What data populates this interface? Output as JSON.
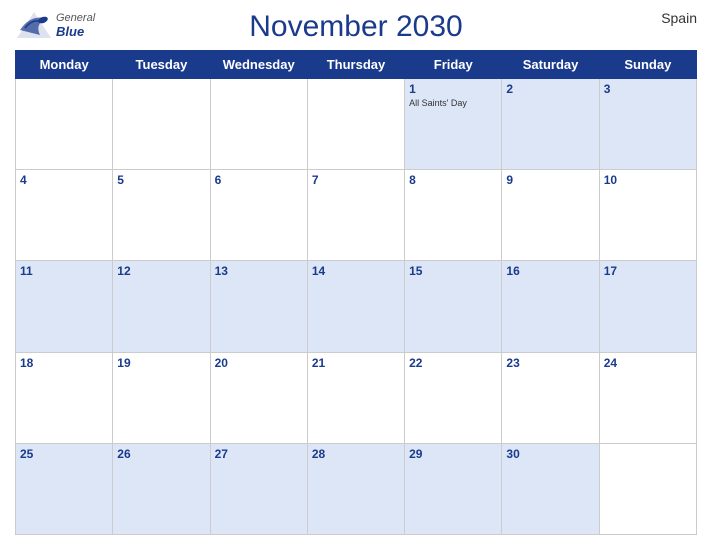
{
  "header": {
    "title": "November 2030",
    "country": "Spain",
    "logo_general": "General",
    "logo_blue": "Blue"
  },
  "days_of_week": [
    "Monday",
    "Tuesday",
    "Wednesday",
    "Thursday",
    "Friday",
    "Saturday",
    "Sunday"
  ],
  "weeks": [
    [
      {
        "date": "",
        "holiday": ""
      },
      {
        "date": "",
        "holiday": ""
      },
      {
        "date": "",
        "holiday": ""
      },
      {
        "date": "",
        "holiday": ""
      },
      {
        "date": "1",
        "holiday": "All Saints' Day"
      },
      {
        "date": "2",
        "holiday": ""
      },
      {
        "date": "3",
        "holiday": ""
      }
    ],
    [
      {
        "date": "4",
        "holiday": ""
      },
      {
        "date": "5",
        "holiday": ""
      },
      {
        "date": "6",
        "holiday": ""
      },
      {
        "date": "7",
        "holiday": ""
      },
      {
        "date": "8",
        "holiday": ""
      },
      {
        "date": "9",
        "holiday": ""
      },
      {
        "date": "10",
        "holiday": ""
      }
    ],
    [
      {
        "date": "11",
        "holiday": ""
      },
      {
        "date": "12",
        "holiday": ""
      },
      {
        "date": "13",
        "holiday": ""
      },
      {
        "date": "14",
        "holiday": ""
      },
      {
        "date": "15",
        "holiday": ""
      },
      {
        "date": "16",
        "holiday": ""
      },
      {
        "date": "17",
        "holiday": ""
      }
    ],
    [
      {
        "date": "18",
        "holiday": ""
      },
      {
        "date": "19",
        "holiday": ""
      },
      {
        "date": "20",
        "holiday": ""
      },
      {
        "date": "21",
        "holiday": ""
      },
      {
        "date": "22",
        "holiday": ""
      },
      {
        "date": "23",
        "holiday": ""
      },
      {
        "date": "24",
        "holiday": ""
      }
    ],
    [
      {
        "date": "25",
        "holiday": ""
      },
      {
        "date": "26",
        "holiday": ""
      },
      {
        "date": "27",
        "holiday": ""
      },
      {
        "date": "28",
        "holiday": ""
      },
      {
        "date": "29",
        "holiday": ""
      },
      {
        "date": "30",
        "holiday": ""
      },
      {
        "date": "",
        "holiday": ""
      }
    ]
  ]
}
